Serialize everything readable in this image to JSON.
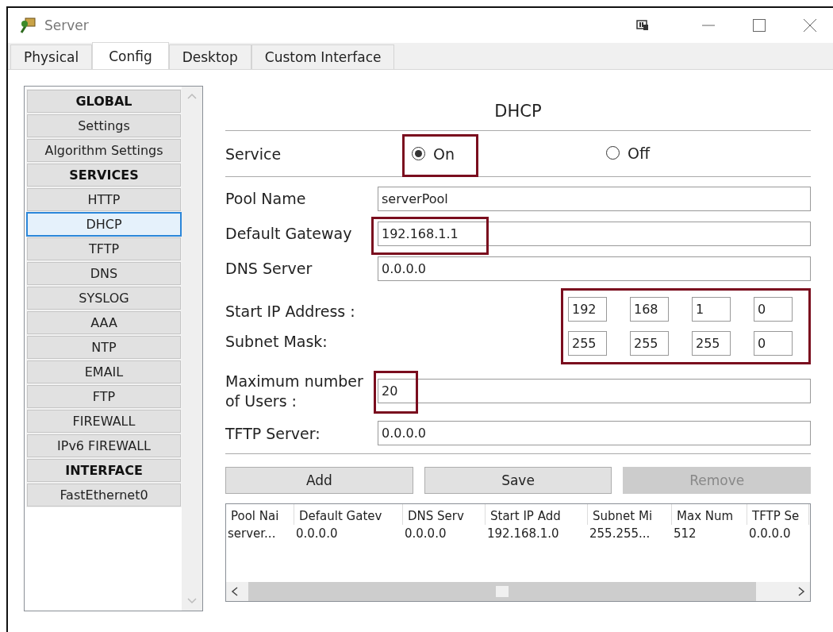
{
  "window": {
    "title": "Server"
  },
  "tabs": [
    {
      "label": "Physical",
      "selected": false
    },
    {
      "label": "Config",
      "selected": true
    },
    {
      "label": "Desktop",
      "selected": false
    },
    {
      "label": "Custom Interface",
      "selected": false
    }
  ],
  "sidebar": {
    "items": [
      {
        "label": "GLOBAL",
        "kind": "header",
        "selected": false
      },
      {
        "label": "Settings",
        "kind": "item",
        "selected": false
      },
      {
        "label": "Algorithm Settings",
        "kind": "item",
        "selected": false
      },
      {
        "label": "SERVICES",
        "kind": "header",
        "selected": false
      },
      {
        "label": "HTTP",
        "kind": "item",
        "selected": false
      },
      {
        "label": "DHCP",
        "kind": "item",
        "selected": true
      },
      {
        "label": "TFTP",
        "kind": "item",
        "selected": false
      },
      {
        "label": "DNS",
        "kind": "item",
        "selected": false
      },
      {
        "label": "SYSLOG",
        "kind": "item",
        "selected": false
      },
      {
        "label": "AAA",
        "kind": "item",
        "selected": false
      },
      {
        "label": "NTP",
        "kind": "item",
        "selected": false
      },
      {
        "label": "EMAIL",
        "kind": "item",
        "selected": false
      },
      {
        "label": "FTP",
        "kind": "item",
        "selected": false
      },
      {
        "label": "FIREWALL",
        "kind": "item",
        "selected": false
      },
      {
        "label": "IPv6 FIREWALL",
        "kind": "item",
        "selected": false
      },
      {
        "label": "INTERFACE",
        "kind": "header",
        "selected": false
      },
      {
        "label": "FastEthernet0",
        "kind": "item",
        "selected": false
      }
    ]
  },
  "panel": {
    "title": "DHCP",
    "service": {
      "label": "Service",
      "options": [
        {
          "label": "On",
          "selected": true,
          "highlighted": true
        },
        {
          "label": "Off",
          "selected": false,
          "highlighted": false
        }
      ]
    },
    "fields": [
      {
        "label": "Pool Name",
        "value": "serverPool",
        "highlighted": false
      },
      {
        "label": "Default Gateway",
        "value": "192.168.1.1",
        "highlighted": true
      },
      {
        "label": "DNS Server",
        "value": "0.0.0.0",
        "highlighted": false
      }
    ],
    "octet_fields": {
      "highlighted": true,
      "rows": [
        {
          "label": "Start IP Address :",
          "octets": [
            "192",
            "168",
            "1",
            "0"
          ]
        },
        {
          "label": "Subnet Mask:",
          "octets": [
            "255",
            "255",
            "255",
            "0"
          ]
        }
      ]
    },
    "fields_2": [
      {
        "label": "Maximum number of Users :",
        "value": "20",
        "highlighted": true
      },
      {
        "label": "TFTP Server:",
        "value": "0.0.0.0",
        "highlighted": false
      }
    ],
    "buttons": [
      {
        "label": "Add",
        "disabled": false
      },
      {
        "label": "Save",
        "disabled": false
      },
      {
        "label": "Remove",
        "disabled": true
      }
    ],
    "table": {
      "columns": [
        "Pool Nai",
        "Default Gatev",
        "DNS Serv",
        "Start IP Add",
        "Subnet Mi",
        "Max Num",
        "TFTP Se"
      ],
      "rows": [
        [
          "server...",
          "0.0.0.0",
          "0.0.0.0",
          "192.168.1.0",
          "255.255...",
          "512",
          "0.0.0.0"
        ]
      ]
    }
  }
}
